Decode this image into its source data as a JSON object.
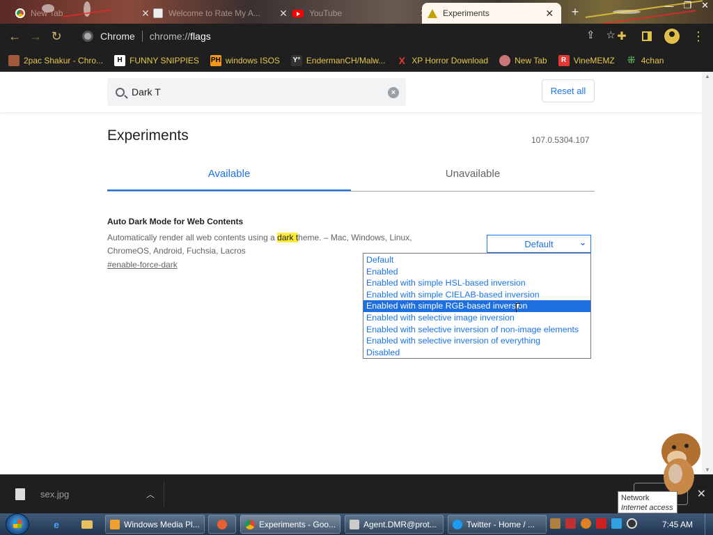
{
  "tabs": [
    {
      "title": "New Tab",
      "icon": "chrome-icon"
    },
    {
      "title": "Welcome to Rate My A...",
      "icon": "page-icon"
    },
    {
      "title": "YouTube",
      "icon": "youtube-icon"
    },
    {
      "title": "Experiments",
      "icon": "warning-icon",
      "active": true
    }
  ],
  "omnibox": {
    "site": "Chrome",
    "scheme": "chrome://",
    "path": "flags"
  },
  "bookmarks": [
    {
      "label": "2pac Shakur - Chro...",
      "icon": "image-icon"
    },
    {
      "label": "FUNNY SNIPPIES",
      "icon": "h-icon",
      "glyph": "H"
    },
    {
      "label": "windows ISOS",
      "icon": "ph-icon",
      "glyph": "PH"
    },
    {
      "label": "EndermanCH/Malw...",
      "icon": "yp-icon",
      "glyph": "Y°"
    },
    {
      "label": "XP Horror Download",
      "icon": "x-icon",
      "glyph": "X"
    },
    {
      "label": "New Tab",
      "icon": "globe-icon"
    },
    {
      "label": "VineMEMZ",
      "icon": "r-icon",
      "glyph": "R"
    },
    {
      "label": "4chan",
      "icon": "clover-icon",
      "glyph": "⁜"
    }
  ],
  "search": {
    "value": "Dark T",
    "clear_glyph": "×"
  },
  "reset_label": "Reset all",
  "page_title": "Experiments",
  "version": "107.0.5304.107",
  "tab_available": "Available",
  "tab_unavailable": "Unavailable",
  "flag": {
    "name": "Auto Dark Mode for Web Contents",
    "desc_before": "Automatically render all web contents using a ",
    "desc_highlight": "dark t",
    "desc_after": "heme. – Mac, Windows, Linux, ChromeOS, Android, Fuchsia, Lacros",
    "anchor": "#enable-force-dark",
    "selected_value": "Default",
    "options": [
      "Default",
      "Enabled",
      "Enabled with simple HSL-based inversion",
      "Enabled with simple CIELAB-based inversion",
      "Enabled with simple RGB-based inversion",
      "Enabled with selective image inversion",
      "Enabled with selective inversion of non-image elements",
      "Enabled with selective inversion of everything",
      "Disabled"
    ],
    "highlighted_option_index": 4
  },
  "download": {
    "filename": "sex.jpg"
  },
  "tooltip": {
    "title": "Network",
    "subtitle": "Internet access"
  },
  "taskbar": {
    "tasks": [
      {
        "label": "Windows Media Pl...",
        "icon": "media-player-icon"
      },
      {
        "label": "",
        "icon": "app-icon"
      },
      {
        "label": "Experiments - Goo...",
        "icon": "chrome-icon",
        "active": true
      },
      {
        "label": "Agent.DMR@prot...",
        "icon": "app-window-icon"
      },
      {
        "label": "Twitter - Home / ...",
        "icon": "twitter-icon"
      }
    ],
    "clock": "7:45 AM"
  },
  "colors": {
    "accent": "#1a73e8",
    "selection": "#1e6fe0",
    "highlight": "#ffeb3b",
    "bookmark_text": "#e8c84a"
  }
}
